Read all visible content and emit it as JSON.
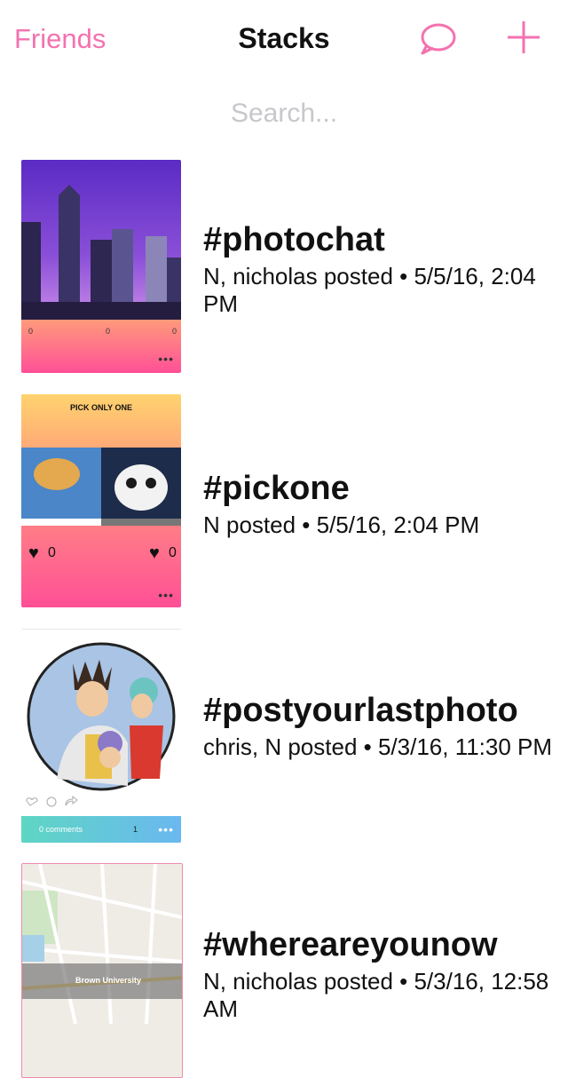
{
  "nav": {
    "left_label": "Friends",
    "title": "Stacks",
    "chat_icon": "chat-bubble-icon",
    "add_icon": "plus-icon",
    "accent": "#f472b0"
  },
  "search": {
    "placeholder": "Search..."
  },
  "stacks": [
    {
      "tag": "#photochat",
      "subtitle": "N, nicholas posted • 5/5/16, 2:04 PM",
      "counts": [
        "0",
        "0",
        "0"
      ]
    },
    {
      "tag": "#pickone",
      "subtitle": "N posted • 5/5/16, 2:04 PM",
      "header": "PICK ONLY ONE",
      "left_count": "0",
      "right_count": "0"
    },
    {
      "tag": "#postyourlastphoto",
      "subtitle": "chris, N posted • 5/3/16, 11:30 PM",
      "comments": "0 comments",
      "likes": "1"
    },
    {
      "tag": "#whereareyounow",
      "subtitle": "N, nicholas posted • 5/3/16, 12:58 AM",
      "map_label": "Brown University"
    }
  ]
}
